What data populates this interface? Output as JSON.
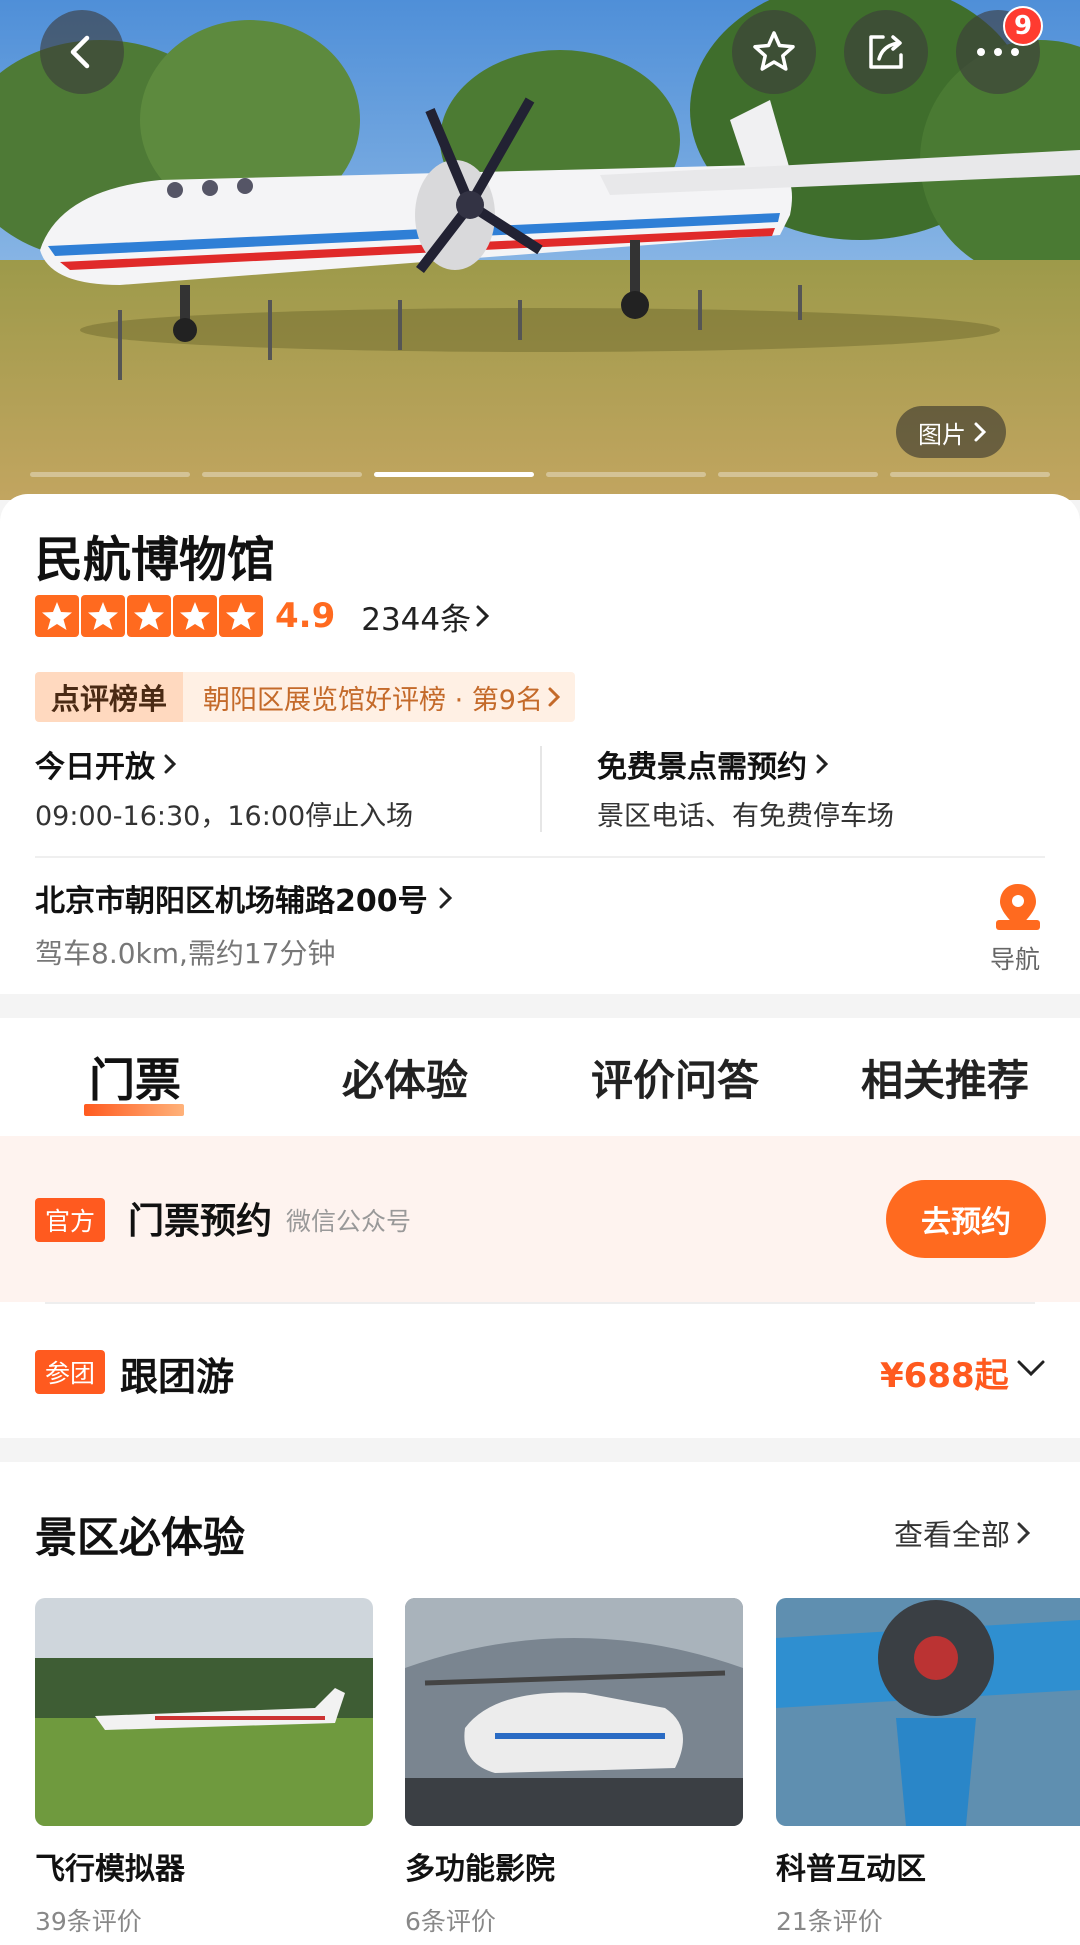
{
  "hero": {
    "notification_count": "9",
    "photo_label": "图片",
    "slide_count": 6,
    "active_slide": 3
  },
  "info": {
    "title": "民航博物馆",
    "rating": {
      "stars": 5,
      "score": "4.9",
      "reviews": "2344条"
    },
    "rank": {
      "label": "点评榜单",
      "text": "朝阳区展览馆好评榜 · 第9名"
    },
    "hours": {
      "head": "今日开放",
      "sub": "09:00-16:30，16:00停止入场"
    },
    "booking": {
      "head": "免费景点需预约",
      "sub": "景区电话、有免费停车场"
    },
    "address": {
      "line": "北京市朝阳区机场辅路200号",
      "sub": "驾车8.0km,需约17分钟"
    },
    "nav_label": "导航"
  },
  "tabs": [
    "门票",
    "必体验",
    "评价问答",
    "相关推荐"
  ],
  "ticket": {
    "tag": "官方",
    "title": "门票预约",
    "source": "微信公众号",
    "button": "去预约"
  },
  "tour": {
    "tag": "参团",
    "title": "跟团游",
    "price": "¥688起"
  },
  "experience": {
    "title": "景区必体验",
    "see_all": "查看全部",
    "items": [
      {
        "name": "飞行模拟器",
        "reviews": "39条评价"
      },
      {
        "name": "多功能影院",
        "reviews": "6条评价"
      },
      {
        "name": "科普互动区",
        "reviews": "21条评价"
      }
    ]
  },
  "colors": {
    "accent": "#ff6a1f",
    "rank_bg": "#ffd9bf",
    "ticket_bg": "#fef3ef"
  }
}
